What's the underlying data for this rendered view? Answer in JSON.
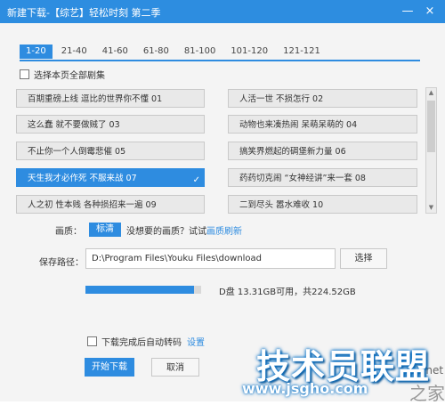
{
  "window": {
    "title": "新建下载-【综艺】轻松时刻 第二季",
    "minimize_glyph": "—",
    "close_glyph": "×"
  },
  "tabs": [
    "1-20",
    "21-40",
    "41-60",
    "61-80",
    "81-100",
    "101-120",
    "121-121"
  ],
  "select_all_label": "选择本页全部剧集",
  "episodes": [
    "百期重磅上线 逗比的世界你不懂 01",
    "人活一世 不损怎行 02",
    "这么蠢 就不要做贼了 03",
    "动物也来凑热闹 呆萌呆萌的 04",
    "不止你一个人倒霉悲催 05",
    "搞笑界燃起的碉堡新力量 06",
    "天生我才必作死 不服来战 07",
    "药药切克闹 “女神经讲”来一套 08",
    "人之初 性本贱 各种损招来一遍 09",
    "二到尽头 嚣水难收 10"
  ],
  "selected_episode_index": 6,
  "scrollbar": {
    "up_glyph": "▲",
    "down_glyph": "▼"
  },
  "quality": {
    "label": "画质：",
    "selected": "标清",
    "hint": "没想要的画质？试试",
    "link": "画质刷新"
  },
  "save": {
    "label": "保存路径：",
    "path": "D:\\Program Files\\Youku Files\\download",
    "choose_button": "选择"
  },
  "disk": {
    "text": "D盘 13.31GB可用，共224.52GB",
    "used_fraction": 0.94
  },
  "auto_convert": {
    "label": "下载完成后自动转码",
    "link": "设置"
  },
  "buttons": {
    "start": "开始下载",
    "cancel": "取消"
  },
  "watermark": {
    "main": "技术员联盟",
    "url": "www.jsgho.com",
    "suffix_url": "j51.net",
    "side": "之家"
  },
  "colors": {
    "accent": "#2e8ce0",
    "titlebar": "#2d8de0"
  },
  "icons": {
    "tick": "✓"
  }
}
